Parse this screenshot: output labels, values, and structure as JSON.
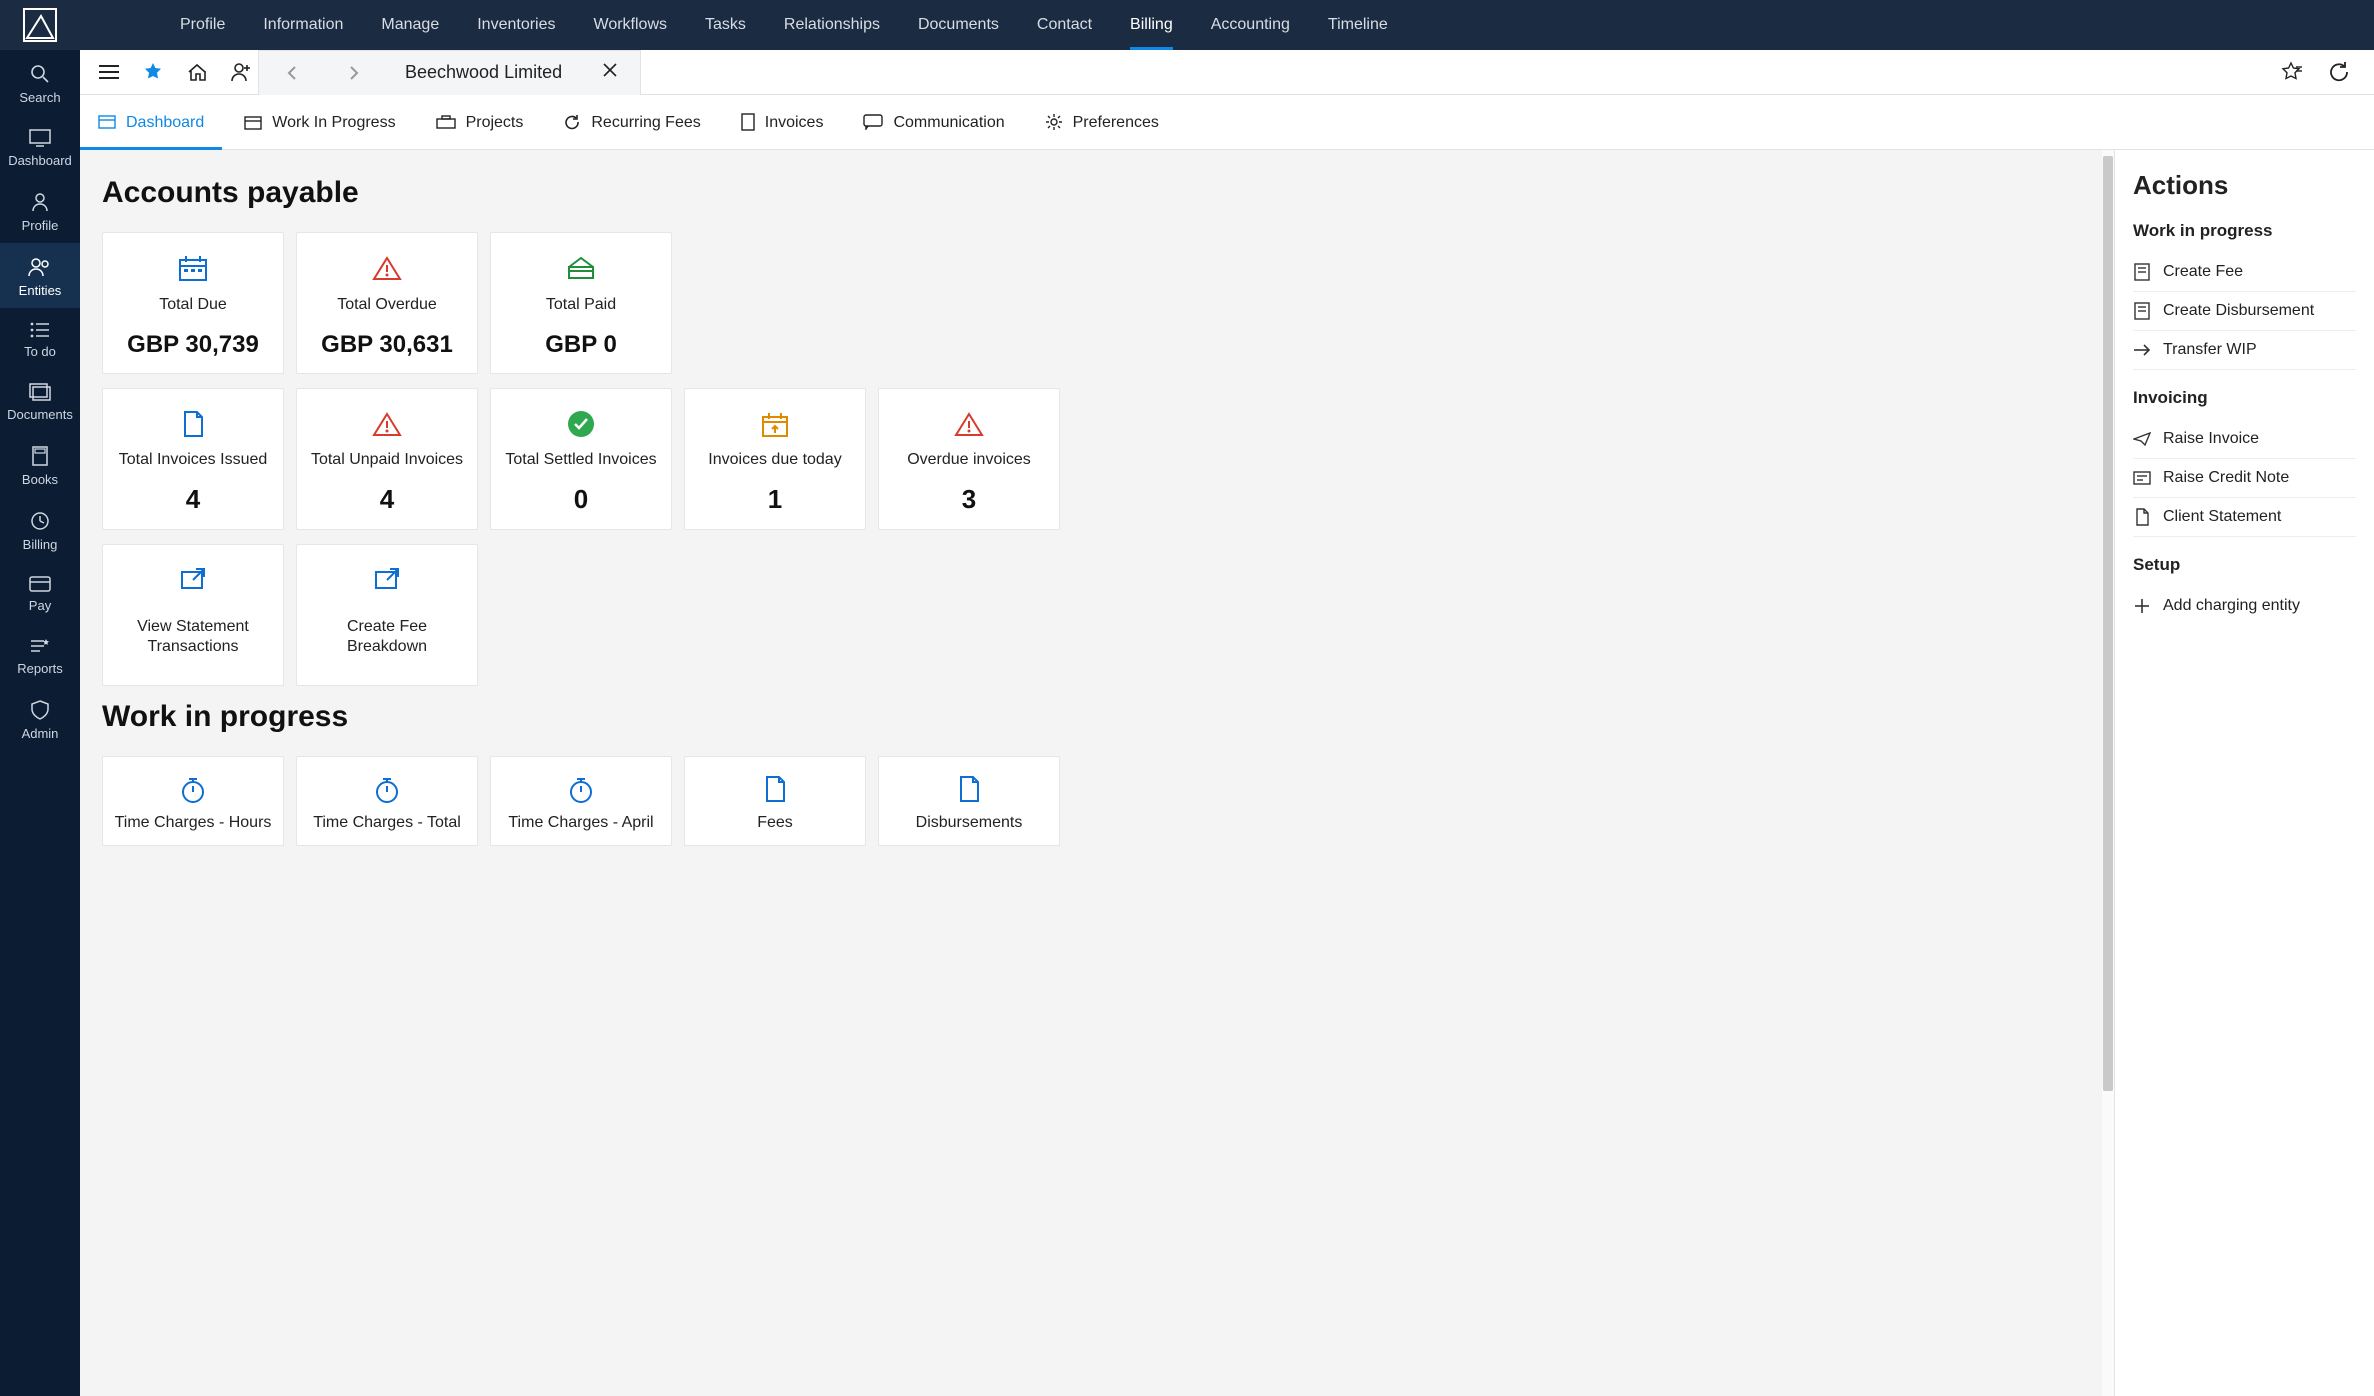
{
  "topnav": [
    {
      "label": "Profile"
    },
    {
      "label": "Information"
    },
    {
      "label": "Manage"
    },
    {
      "label": "Inventories"
    },
    {
      "label": "Workflows"
    },
    {
      "label": "Tasks"
    },
    {
      "label": "Relationships"
    },
    {
      "label": "Documents"
    },
    {
      "label": "Contact"
    },
    {
      "label": "Billing",
      "active": true
    },
    {
      "label": "Accounting"
    },
    {
      "label": "Timeline"
    }
  ],
  "sidebar": [
    {
      "label": "Search",
      "icon": "search"
    },
    {
      "label": "Dashboard",
      "icon": "monitor"
    },
    {
      "label": "Profile",
      "icon": "person"
    },
    {
      "label": "Entities",
      "icon": "people",
      "active": true
    },
    {
      "label": "To do",
      "icon": "list"
    },
    {
      "label": "Documents",
      "icon": "folders"
    },
    {
      "label": "Books",
      "icon": "calc"
    },
    {
      "label": "Billing",
      "icon": "clock"
    },
    {
      "label": "Pay",
      "icon": "card"
    },
    {
      "label": "Reports",
      "icon": "liststar"
    },
    {
      "label": "Admin",
      "icon": "shield"
    }
  ],
  "context": {
    "title": "Beechwood Limited"
  },
  "subtabs": [
    {
      "label": "Dashboard",
      "active": true
    },
    {
      "label": "Work In Progress"
    },
    {
      "label": "Projects"
    },
    {
      "label": "Recurring Fees"
    },
    {
      "label": "Invoices"
    },
    {
      "label": "Communication"
    },
    {
      "label": "Preferences"
    }
  ],
  "sections": {
    "accounts_payable_title": "Accounts payable",
    "wip_title": "Work in progress"
  },
  "cards_row1": [
    {
      "title": "Total Due",
      "value": "GBP 30,739",
      "icon": "calendar",
      "color": "#0f6ed1"
    },
    {
      "title": "Total Overdue",
      "value": "GBP 30,631",
      "icon": "warn",
      "color": "#d83b2b"
    },
    {
      "title": "Total Paid",
      "value": "GBP 0",
      "icon": "bank",
      "color": "#1f8f3a"
    }
  ],
  "cards_row2": [
    {
      "title": "Total Invoices Issued",
      "value": "4",
      "icon": "page",
      "color": "#0f6ed1"
    },
    {
      "title": "Total Unpaid Invoices",
      "value": "4",
      "icon": "warn",
      "color": "#d83b2b"
    },
    {
      "title": "Total Settled Invoices",
      "value": "0",
      "icon": "checkfill",
      "color": "#1f9d3f"
    },
    {
      "title": "Invoices due today",
      "value": "1",
      "icon": "calup",
      "color": "#e08a00"
    },
    {
      "title": "Overdue invoices",
      "value": "3",
      "icon": "warn",
      "color": "#d83b2b"
    }
  ],
  "cards_row3": [
    {
      "title": "View Statement Transactions",
      "icon": "open",
      "color": "#0f6ed1"
    },
    {
      "title": "Create Fee Breakdown",
      "icon": "open",
      "color": "#0f6ed1"
    }
  ],
  "cards_row4": [
    {
      "title": "Time Charges - Hours",
      "icon": "stopwatch",
      "color": "#0f6ed1"
    },
    {
      "title": "Time Charges - Total",
      "icon": "stopwatch",
      "color": "#0f6ed1"
    },
    {
      "title": "Time Charges - April",
      "icon": "stopwatch",
      "color": "#0f6ed1"
    },
    {
      "title": "Fees",
      "icon": "page",
      "color": "#0f6ed1"
    },
    {
      "title": "Disbursements",
      "icon": "page",
      "color": "#0f6ed1"
    }
  ],
  "actions": {
    "title": "Actions",
    "groups": [
      {
        "title": "Work in progress",
        "items": [
          {
            "label": "Create Fee",
            "icon": "receipt"
          },
          {
            "label": "Create Disbursement",
            "icon": "receipt"
          },
          {
            "label": "Transfer WIP",
            "icon": "arrow"
          }
        ]
      },
      {
        "title": "Invoicing",
        "items": [
          {
            "label": "Raise Invoice",
            "icon": "send"
          },
          {
            "label": "Raise Credit Note",
            "icon": "note"
          },
          {
            "label": "Client Statement",
            "icon": "page"
          }
        ]
      },
      {
        "title": "Setup",
        "items": [
          {
            "label": "Add charging entity",
            "icon": "plus"
          }
        ]
      }
    ]
  }
}
